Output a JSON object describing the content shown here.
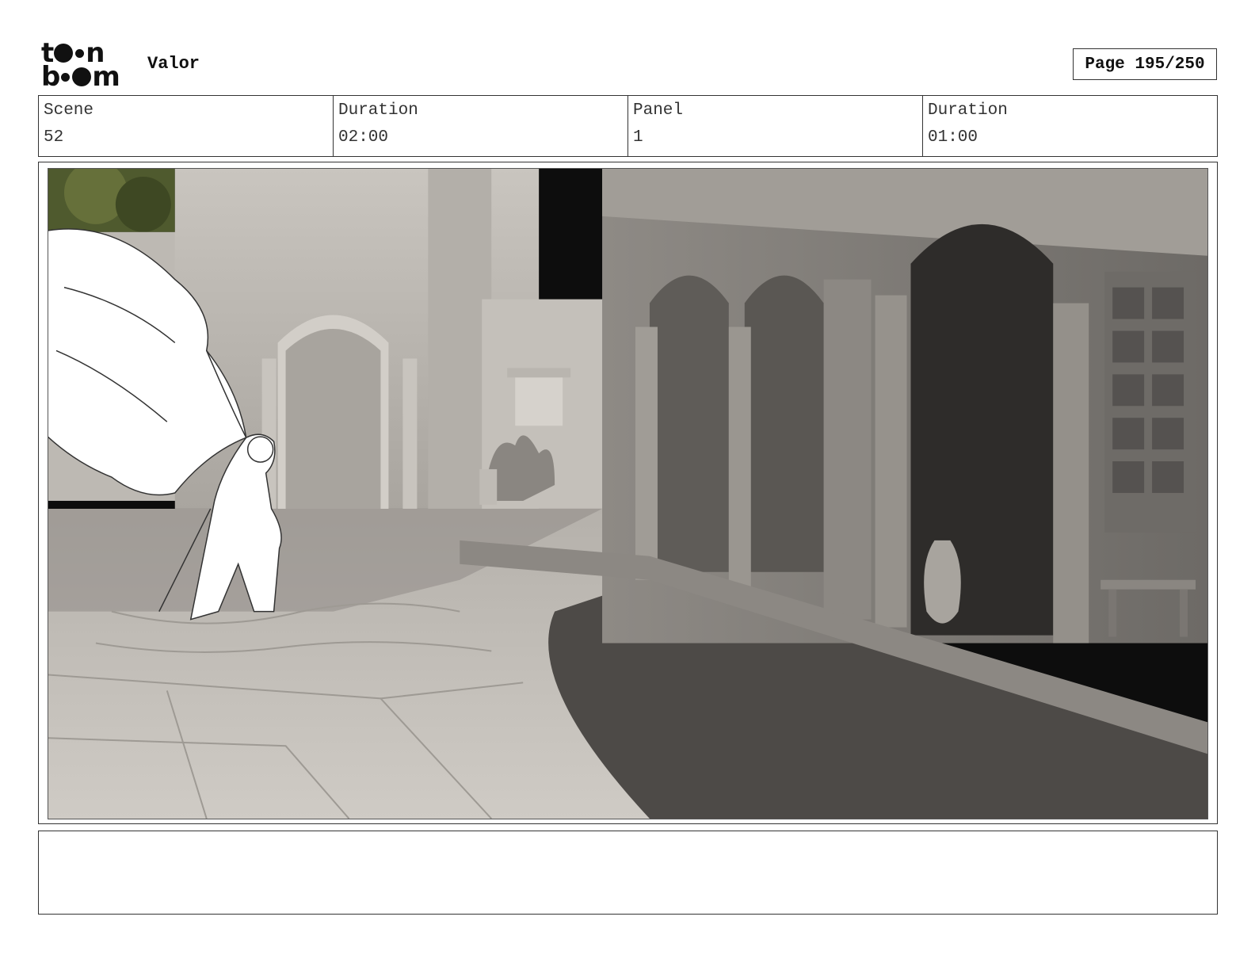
{
  "header": {
    "logo_text": "toon boom",
    "project_title": "Valor",
    "page_label": "Page 195/250"
  },
  "info": {
    "scene_label": "Scene",
    "scene_value": "52",
    "scene_duration_label": "Duration",
    "scene_duration_value": "02:00",
    "panel_label": "Panel",
    "panel_value": "1",
    "panel_duration_label": "Duration",
    "panel_duration_value": "01:00"
  },
  "notes": {
    "text": ""
  }
}
